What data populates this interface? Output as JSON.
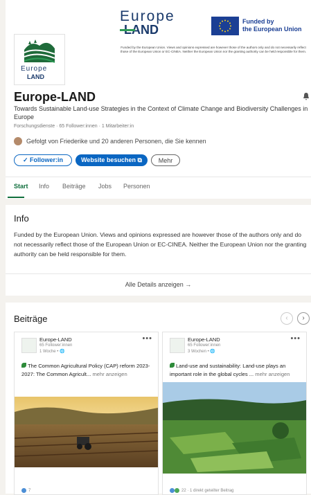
{
  "banner": {
    "logo_line1": "Europe",
    "logo_line2": "LAND",
    "funded_line1": "Funded by",
    "funded_line2": "the European Union",
    "disclaimer": "Funded by the European Union. Views and opinions expressed are however those of the authors only and do not necessarily reflect those of the European Union or EC-CINEA. Neither the European Union nor the granting authority can be held responsible for them."
  },
  "company": {
    "logo_line1": "Europe",
    "logo_line2": "LAND",
    "name": "Europe-LAND",
    "tagline": "Towards Sustainable Land-use Strategies in the Context of Climate Change and Biodiversity Challenges in Europe",
    "meta": "Forschungsdienste · 65 Follower:innen · 1 Mitarbeiter:in",
    "followed_by": "Gefolgt von Friederike und 20 anderen Personen, die Sie kennen"
  },
  "actions": {
    "follow": "✓ Follower:in",
    "visit": "Website besuchen ⧉",
    "more": "Mehr"
  },
  "tabs": [
    "Start",
    "Info",
    "Beiträge",
    "Jobs",
    "Personen"
  ],
  "info": {
    "heading": "Info",
    "text": "Funded by the European Union. Views and opinions expressed are however those of the authors only and do not necessarily reflect those of the European Union or EC-CINEA. Neither the European Union nor the granting authority can be held responsible for them.",
    "details_link": "Alle Details anzeigen →"
  },
  "posts_section": {
    "heading": "Beiträge",
    "posts": [
      {
        "author": "Europe-LAND",
        "followers": "65 Follower:innen",
        "time": "1 Woche • 🌐",
        "text": "The Common Agricultural Policy (CAP) reform 2023-2027: The Common Agricult...",
        "more": "mehr anzeigen",
        "reactions": "7"
      },
      {
        "author": "Europe-LAND",
        "followers": "65 Follower:innen",
        "time": "3 Wochen • 🌐",
        "text": "Land-use and sustainability: Land-use plays an important role in the global cycles ...",
        "more": "mehr anzeigen",
        "reactions": "22 · 1 direkt geteilter Beitrag"
      }
    ]
  },
  "colors": {
    "brand_blue": "#1a3a6b",
    "brand_green": "#2e9c57",
    "linkedin_blue": "#0a66c2",
    "active_tab": "#0f6e3c"
  }
}
